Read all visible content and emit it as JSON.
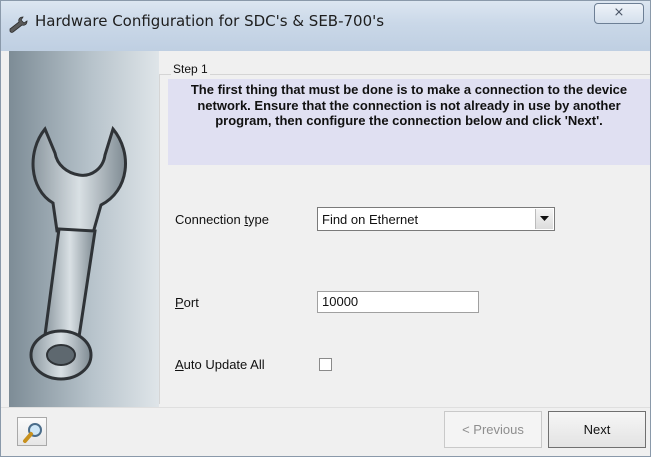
{
  "window": {
    "title": "Hardware Configuration for SDC's & SEB-700's",
    "close_glyph": "⨯"
  },
  "step": {
    "legend": "Step 1",
    "instructions": "The first thing that must be done is to make a connection to the device network. Ensure that the connection is not already in use by another program, then configure the connection below and click 'Next'."
  },
  "form": {
    "connection_type": {
      "label_before": "Connection ",
      "label_accel": "t",
      "label_after": "ype",
      "selected": "Find on Ethernet"
    },
    "port": {
      "label_accel": "P",
      "label_after": "ort",
      "value": "10000"
    },
    "auto_update": {
      "label_accel": "A",
      "label_after": "uto Update All",
      "checked": false
    }
  },
  "buttons": {
    "previous": "< Previous",
    "next": "Next"
  },
  "icons": {
    "title": "wrench-app-icon",
    "side": "wrench-icon",
    "search": "magnifier-icon"
  },
  "colors": {
    "info_background": "#e0e0f2",
    "panel_gradient_dark": "#7d8c96",
    "panel_gradient_light": "#dfe5e9"
  }
}
